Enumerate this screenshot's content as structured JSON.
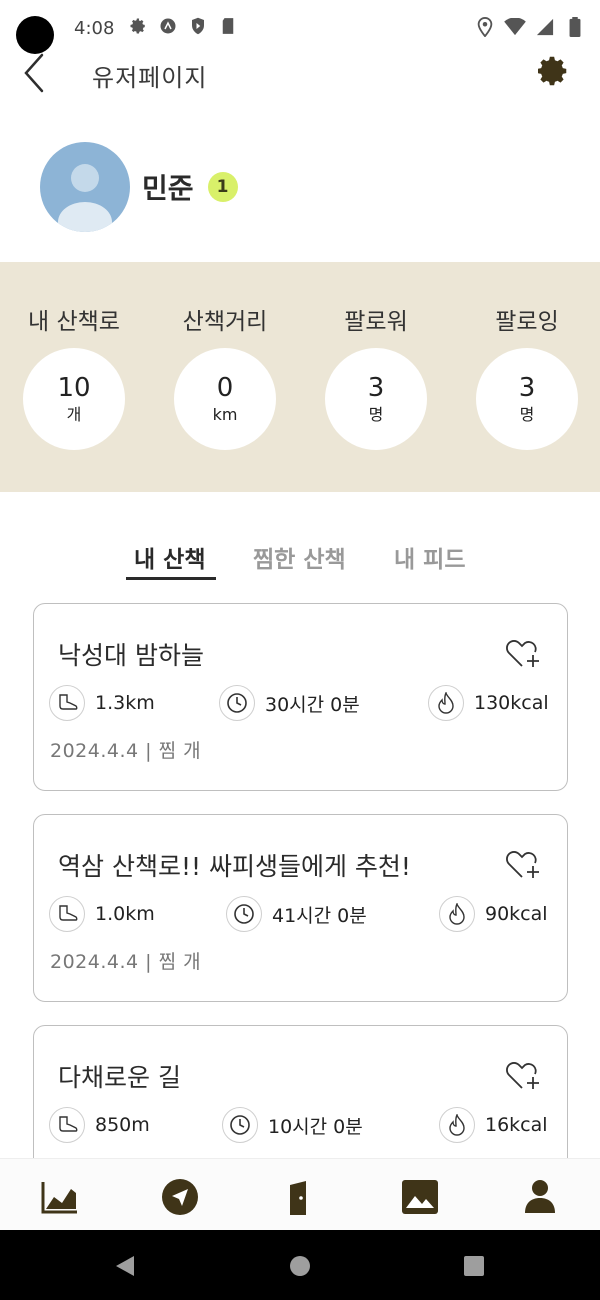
{
  "status_bar": {
    "time": "4:08"
  },
  "app_bar": {
    "title": "유저페이지"
  },
  "profile": {
    "name": "민준",
    "level": "1"
  },
  "stats": [
    {
      "label": "내 산책로",
      "value": "10",
      "unit": "개"
    },
    {
      "label": "산책거리",
      "value": "0",
      "unit": "km"
    },
    {
      "label": "팔로워",
      "value": "3",
      "unit": "명"
    },
    {
      "label": "팔로잉",
      "value": "3",
      "unit": "명"
    }
  ],
  "tabs": [
    {
      "label": "내 산책",
      "active": true
    },
    {
      "label": "찜한 산책",
      "active": false
    },
    {
      "label": "내 피드",
      "active": false
    }
  ],
  "walks": [
    {
      "title": "낙성대 밤하늘",
      "distance": "1.3km",
      "duration": "30시간 0분",
      "calories": "130kcal",
      "meta": "2024.4.4  |  찜 개"
    },
    {
      "title": "역삼 산책로!! 싸피생들에게 추천!",
      "distance": "1.0km",
      "duration": "41시간 0분",
      "calories": "90kcal",
      "meta": "2024.4.4  |  찜 개"
    },
    {
      "title": "다채로운 길",
      "distance": "850m",
      "duration": "10시간 0분",
      "calories": "16kcal",
      "meta": ""
    }
  ],
  "colors": {
    "accent": "#3f3418",
    "stats_bg": "#ece6d6",
    "level_badge": "#d9f06a",
    "avatar_bg": "#8db4d6"
  },
  "icons": {
    "bottom_nav": [
      "chart-icon",
      "navigation-arrow-icon",
      "door-icon",
      "image-icon",
      "person-icon"
    ],
    "metrics": [
      "shoe-icon",
      "clock-icon",
      "flame-icon"
    ]
  }
}
